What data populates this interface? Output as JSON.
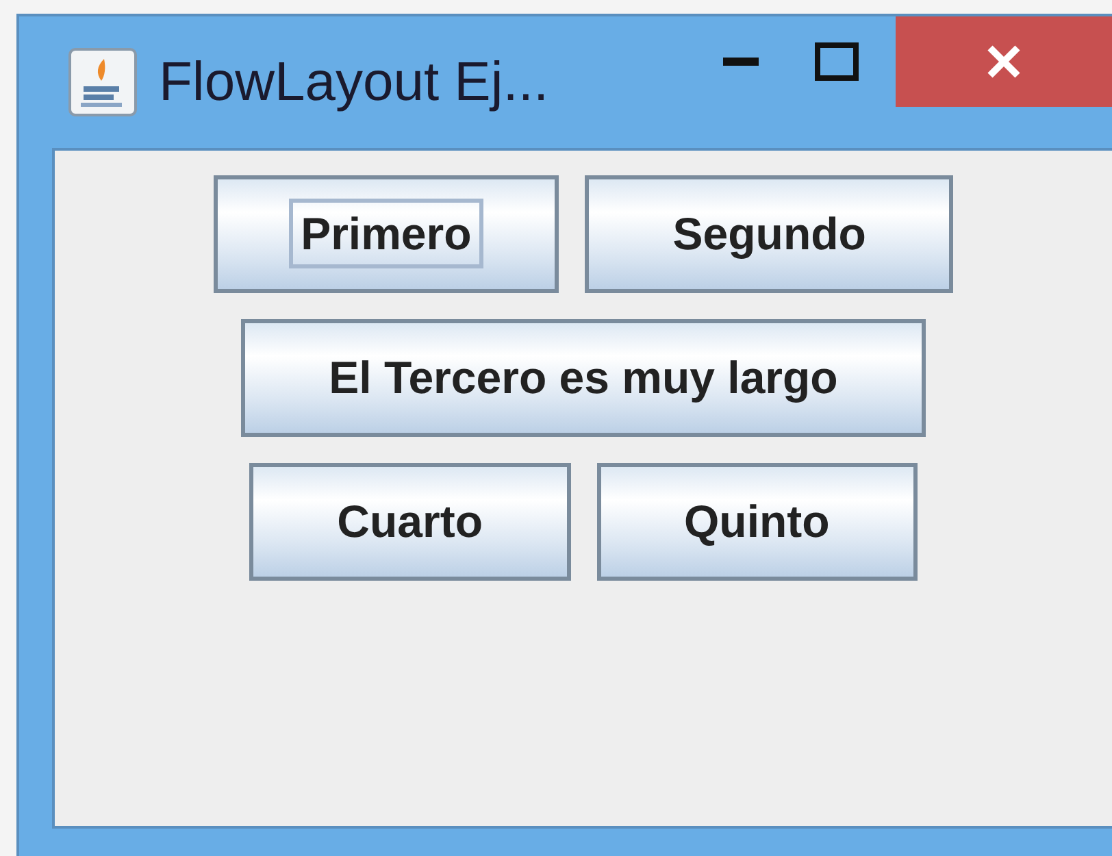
{
  "window": {
    "title": "FlowLayout Ej..."
  },
  "buttons": [
    {
      "label": "Primero",
      "focused": true
    },
    {
      "label": "Segundo",
      "focused": false
    },
    {
      "label": "El Tercero es muy largo",
      "focused": false
    },
    {
      "label": "Cuarto",
      "focused": false
    },
    {
      "label": "Quinto",
      "focused": false
    }
  ]
}
